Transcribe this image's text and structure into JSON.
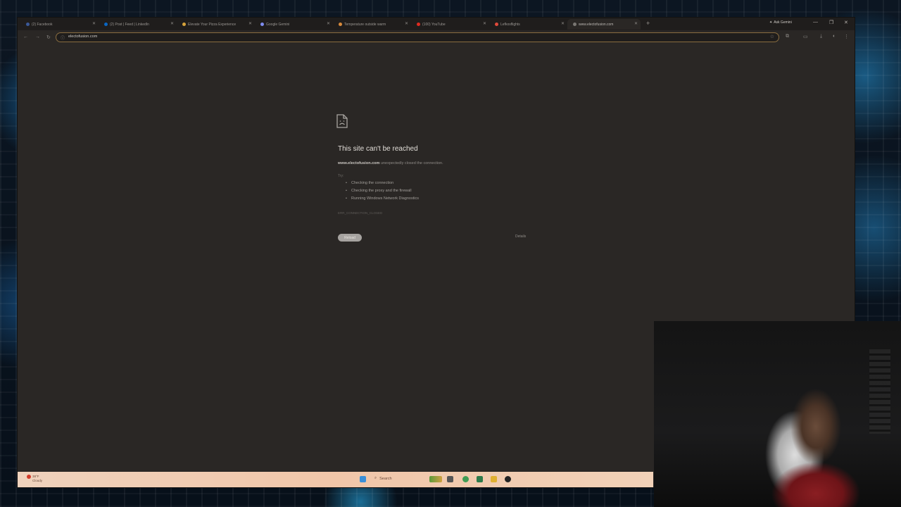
{
  "browser": {
    "tabs": [
      {
        "label": "(2) Facebook",
        "color": "#3b5998",
        "active": false
      },
      {
        "label": "(2) Post | Feed | LinkedIn",
        "color": "#0a66c2",
        "active": false
      },
      {
        "label": "Elevate Your Pizza Experience",
        "color": "#d6a33b",
        "active": false
      },
      {
        "label": "Google Gemini",
        "color": "#7e8cf0",
        "active": false
      },
      {
        "label": "Temperature outside warm",
        "color": "#d88a3b",
        "active": false
      },
      {
        "label": "(100) YouTube",
        "color": "#e02b20",
        "active": false
      },
      {
        "label": "Lefkosflights",
        "color": "#e04a3b",
        "active": false
      },
      {
        "label": "www.electofusion.com",
        "color": "#7a7773",
        "active": true
      }
    ],
    "new_tab": "+",
    "ask_gemini": "Ask Gemini",
    "url": "electofusion.com"
  },
  "error_page": {
    "title": "This site can't be reached",
    "domain": "www.electofusion.com",
    "message": "unexpectedly closed the connection.",
    "try_label": "Try:",
    "suggestions": [
      "Checking the connection",
      "Checking the proxy and the firewall",
      "Running Windows Network Diagnostics"
    ],
    "error_code": "ERR_CONNECTION_CLOSED",
    "reload_label": "Reload",
    "details_label": "Details"
  },
  "taskbar": {
    "weather_temp": "38°F",
    "weather_desc": "Cloudy",
    "search_label": "Search"
  }
}
